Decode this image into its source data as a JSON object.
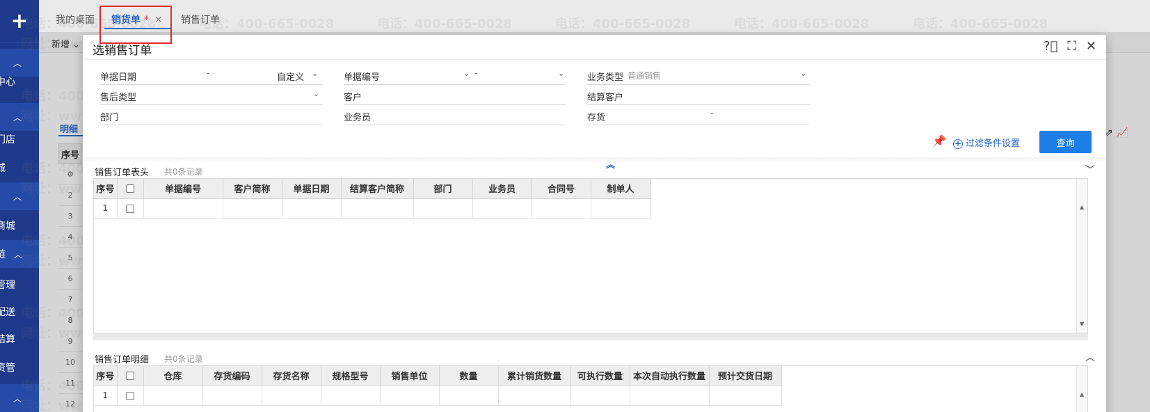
{
  "sidebar": {
    "items": [
      "中心",
      "门店",
      "城",
      "商城",
      "链",
      "管理",
      "配送",
      "结算",
      "资管"
    ]
  },
  "tabs": [
    {
      "label": "我的桌面"
    },
    {
      "label": "销货单",
      "dirty": "*"
    },
    {
      "label": "销售订单"
    }
  ],
  "toolbar": {
    "new_label": "新增"
  },
  "background": {
    "detail_tab": "明细",
    "seq_header": "序号",
    "row_numbers": [
      "2",
      "3",
      "4",
      "5",
      "6",
      "7",
      "8",
      "9",
      "10",
      "11",
      "12"
    ]
  },
  "modal": {
    "title": "选销售订单",
    "filters": {
      "doc_date_label": "单据日期",
      "doc_date_sep": "-",
      "doc_date_mode": "自定义",
      "doc_no_label": "单据编号",
      "doc_no_sep": "-",
      "biz_type_label": "业务类型",
      "biz_type_value": "普通销售",
      "aftersale_label": "售后类型",
      "customer_label": "客户",
      "settle_customer_label": "结算客户",
      "dept_label": "部门",
      "salesman_label": "业务员",
      "inventory_label": "存货",
      "inventory_sep": "-"
    },
    "filter_settings": "过滤条件设置",
    "query_button": "查询",
    "header_section": {
      "title": "销售订单表头",
      "count": "共0条记录",
      "columns": [
        "序号",
        "",
        "单据编号",
        "客户简称",
        "单据日期",
        "结算客户简称",
        "部门",
        "业务员",
        "合同号",
        "制单人"
      ],
      "rows": [
        {
          "seq": "1"
        }
      ]
    },
    "detail_section": {
      "title": "销售订单明细",
      "count": "共0条记录",
      "columns": [
        "序号",
        "",
        "仓库",
        "存货编码",
        "存货名称",
        "规格型号",
        "销售单位",
        "数量",
        "累计销货数量",
        "可执行数量",
        "本次自动执行数量",
        "预计交货日期"
      ],
      "rows": [
        {
          "seq": "1"
        }
      ]
    }
  },
  "watermark": {
    "phone": "电话：400-665-0028",
    "site": "网址：www.chanjet.net"
  }
}
